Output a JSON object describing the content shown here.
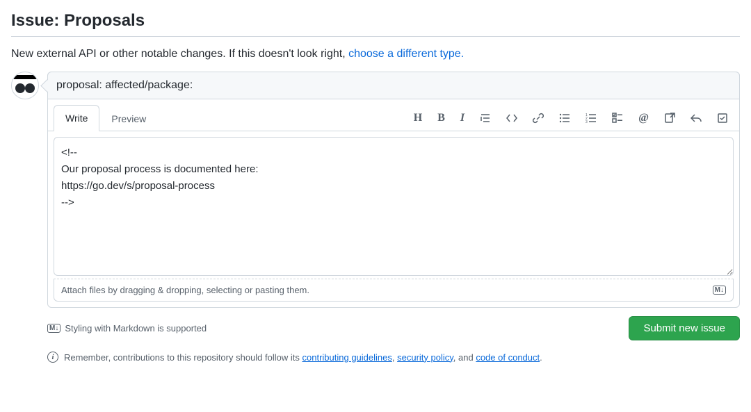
{
  "header": {
    "title": "Issue: Proposals",
    "description_prefix": "New external API or other notable changes. If this doesn't look right, ",
    "choose_type_link": "choose a different type."
  },
  "issue": {
    "title_value": "proposal: affected/package:",
    "body_value": "<!--\nOur proposal process is documented here:\nhttps://go.dev/s/proposal-process\n-->"
  },
  "tabs": {
    "write": "Write",
    "preview": "Preview"
  },
  "attach": {
    "hint": "Attach files by dragging & dropping, selecting or pasting them."
  },
  "footer": {
    "styling_hint": "Styling with Markdown is supported",
    "submit_label": "Submit new issue"
  },
  "contrib": {
    "prefix": "Remember, contributions to this repository should follow its ",
    "guidelines": "contributing guidelines",
    "sep1": ", ",
    "security": "security policy",
    "sep2": ", and ",
    "conduct": "code of conduct",
    "suffix": "."
  },
  "md_badge": "M↓"
}
